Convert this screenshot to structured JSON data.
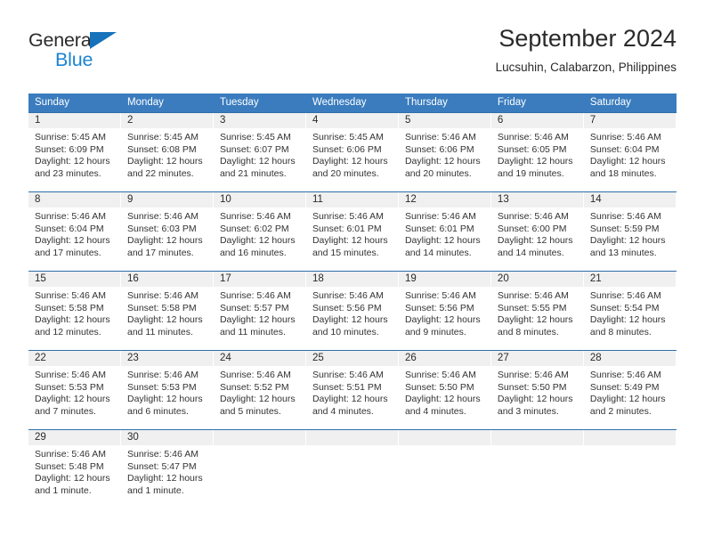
{
  "brand": {
    "name_top": "General",
    "name_bottom": "Blue",
    "triangle_color": "#1672bb",
    "blue_text_color": "#1b84d2"
  },
  "header": {
    "title": "September 2024",
    "subtitle": "Lucsuhin, Calabarzon, Philippines"
  },
  "theme": {
    "header_bg": "#3a7cbe",
    "row_divider": "#2f6fab",
    "daynum_band_bg": "#f0f0f0"
  },
  "weekdays": [
    "Sunday",
    "Monday",
    "Tuesday",
    "Wednesday",
    "Thursday",
    "Friday",
    "Saturday"
  ],
  "weeks": [
    {
      "days": [
        {
          "num": "1",
          "sunrise": "Sunrise: 5:45 AM",
          "sunset": "Sunset: 6:09 PM",
          "daylight1": "Daylight: 12 hours",
          "daylight2": "and 23 minutes."
        },
        {
          "num": "2",
          "sunrise": "Sunrise: 5:45 AM",
          "sunset": "Sunset: 6:08 PM",
          "daylight1": "Daylight: 12 hours",
          "daylight2": "and 22 minutes."
        },
        {
          "num": "3",
          "sunrise": "Sunrise: 5:45 AM",
          "sunset": "Sunset: 6:07 PM",
          "daylight1": "Daylight: 12 hours",
          "daylight2": "and 21 minutes."
        },
        {
          "num": "4",
          "sunrise": "Sunrise: 5:45 AM",
          "sunset": "Sunset: 6:06 PM",
          "daylight1": "Daylight: 12 hours",
          "daylight2": "and 20 minutes."
        },
        {
          "num": "5",
          "sunrise": "Sunrise: 5:46 AM",
          "sunset": "Sunset: 6:06 PM",
          "daylight1": "Daylight: 12 hours",
          "daylight2": "and 20 minutes."
        },
        {
          "num": "6",
          "sunrise": "Sunrise: 5:46 AM",
          "sunset": "Sunset: 6:05 PM",
          "daylight1": "Daylight: 12 hours",
          "daylight2": "and 19 minutes."
        },
        {
          "num": "7",
          "sunrise": "Sunrise: 5:46 AM",
          "sunset": "Sunset: 6:04 PM",
          "daylight1": "Daylight: 12 hours",
          "daylight2": "and 18 minutes."
        }
      ]
    },
    {
      "days": [
        {
          "num": "8",
          "sunrise": "Sunrise: 5:46 AM",
          "sunset": "Sunset: 6:04 PM",
          "daylight1": "Daylight: 12 hours",
          "daylight2": "and 17 minutes."
        },
        {
          "num": "9",
          "sunrise": "Sunrise: 5:46 AM",
          "sunset": "Sunset: 6:03 PM",
          "daylight1": "Daylight: 12 hours",
          "daylight2": "and 17 minutes."
        },
        {
          "num": "10",
          "sunrise": "Sunrise: 5:46 AM",
          "sunset": "Sunset: 6:02 PM",
          "daylight1": "Daylight: 12 hours",
          "daylight2": "and 16 minutes."
        },
        {
          "num": "11",
          "sunrise": "Sunrise: 5:46 AM",
          "sunset": "Sunset: 6:01 PM",
          "daylight1": "Daylight: 12 hours",
          "daylight2": "and 15 minutes."
        },
        {
          "num": "12",
          "sunrise": "Sunrise: 5:46 AM",
          "sunset": "Sunset: 6:01 PM",
          "daylight1": "Daylight: 12 hours",
          "daylight2": "and 14 minutes."
        },
        {
          "num": "13",
          "sunrise": "Sunrise: 5:46 AM",
          "sunset": "Sunset: 6:00 PM",
          "daylight1": "Daylight: 12 hours",
          "daylight2": "and 14 minutes."
        },
        {
          "num": "14",
          "sunrise": "Sunrise: 5:46 AM",
          "sunset": "Sunset: 5:59 PM",
          "daylight1": "Daylight: 12 hours",
          "daylight2": "and 13 minutes."
        }
      ]
    },
    {
      "days": [
        {
          "num": "15",
          "sunrise": "Sunrise: 5:46 AM",
          "sunset": "Sunset: 5:58 PM",
          "daylight1": "Daylight: 12 hours",
          "daylight2": "and 12 minutes."
        },
        {
          "num": "16",
          "sunrise": "Sunrise: 5:46 AM",
          "sunset": "Sunset: 5:58 PM",
          "daylight1": "Daylight: 12 hours",
          "daylight2": "and 11 minutes."
        },
        {
          "num": "17",
          "sunrise": "Sunrise: 5:46 AM",
          "sunset": "Sunset: 5:57 PM",
          "daylight1": "Daylight: 12 hours",
          "daylight2": "and 11 minutes."
        },
        {
          "num": "18",
          "sunrise": "Sunrise: 5:46 AM",
          "sunset": "Sunset: 5:56 PM",
          "daylight1": "Daylight: 12 hours",
          "daylight2": "and 10 minutes."
        },
        {
          "num": "19",
          "sunrise": "Sunrise: 5:46 AM",
          "sunset": "Sunset: 5:56 PM",
          "daylight1": "Daylight: 12 hours",
          "daylight2": "and 9 minutes."
        },
        {
          "num": "20",
          "sunrise": "Sunrise: 5:46 AM",
          "sunset": "Sunset: 5:55 PM",
          "daylight1": "Daylight: 12 hours",
          "daylight2": "and 8 minutes."
        },
        {
          "num": "21",
          "sunrise": "Sunrise: 5:46 AM",
          "sunset": "Sunset: 5:54 PM",
          "daylight1": "Daylight: 12 hours",
          "daylight2": "and 8 minutes."
        }
      ]
    },
    {
      "days": [
        {
          "num": "22",
          "sunrise": "Sunrise: 5:46 AM",
          "sunset": "Sunset: 5:53 PM",
          "daylight1": "Daylight: 12 hours",
          "daylight2": "and 7 minutes."
        },
        {
          "num": "23",
          "sunrise": "Sunrise: 5:46 AM",
          "sunset": "Sunset: 5:53 PM",
          "daylight1": "Daylight: 12 hours",
          "daylight2": "and 6 minutes."
        },
        {
          "num": "24",
          "sunrise": "Sunrise: 5:46 AM",
          "sunset": "Sunset: 5:52 PM",
          "daylight1": "Daylight: 12 hours",
          "daylight2": "and 5 minutes."
        },
        {
          "num": "25",
          "sunrise": "Sunrise: 5:46 AM",
          "sunset": "Sunset: 5:51 PM",
          "daylight1": "Daylight: 12 hours",
          "daylight2": "and 4 minutes."
        },
        {
          "num": "26",
          "sunrise": "Sunrise: 5:46 AM",
          "sunset": "Sunset: 5:50 PM",
          "daylight1": "Daylight: 12 hours",
          "daylight2": "and 4 minutes."
        },
        {
          "num": "27",
          "sunrise": "Sunrise: 5:46 AM",
          "sunset": "Sunset: 5:50 PM",
          "daylight1": "Daylight: 12 hours",
          "daylight2": "and 3 minutes."
        },
        {
          "num": "28",
          "sunrise": "Sunrise: 5:46 AM",
          "sunset": "Sunset: 5:49 PM",
          "daylight1": "Daylight: 12 hours",
          "daylight2": "and 2 minutes."
        }
      ]
    },
    {
      "days": [
        {
          "num": "29",
          "sunrise": "Sunrise: 5:46 AM",
          "sunset": "Sunset: 5:48 PM",
          "daylight1": "Daylight: 12 hours",
          "daylight2": "and 1 minute."
        },
        {
          "num": "30",
          "sunrise": "Sunrise: 5:46 AM",
          "sunset": "Sunset: 5:47 PM",
          "daylight1": "Daylight: 12 hours",
          "daylight2": "and 1 minute."
        },
        {
          "num": "",
          "sunrise": "",
          "sunset": "",
          "daylight1": "",
          "daylight2": ""
        },
        {
          "num": "",
          "sunrise": "",
          "sunset": "",
          "daylight1": "",
          "daylight2": ""
        },
        {
          "num": "",
          "sunrise": "",
          "sunset": "",
          "daylight1": "",
          "daylight2": ""
        },
        {
          "num": "",
          "sunrise": "",
          "sunset": "",
          "daylight1": "",
          "daylight2": ""
        },
        {
          "num": "",
          "sunrise": "",
          "sunset": "",
          "daylight1": "",
          "daylight2": ""
        }
      ]
    }
  ]
}
